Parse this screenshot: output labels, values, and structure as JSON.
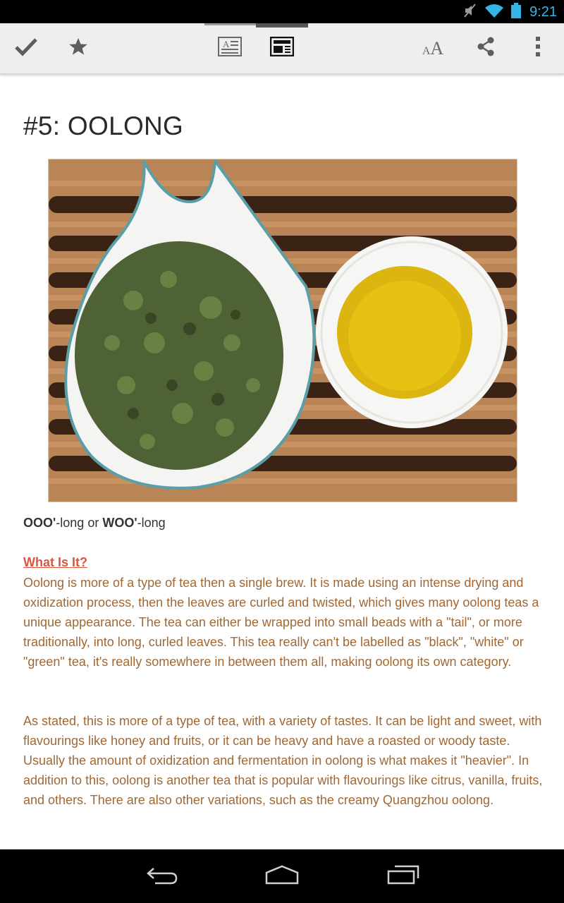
{
  "status_bar": {
    "time": "9:21",
    "icons": [
      "mute-icon",
      "wifi-icon",
      "battery-icon"
    ]
  },
  "action_bar": {
    "buttons": [
      "mark-read-check-icon",
      "star-icon",
      "article-view-icon",
      "web-view-icon",
      "text-size-icon",
      "share-icon",
      "overflow-menu-icon"
    ],
    "text_size_label": "AA"
  },
  "article": {
    "title": "#5: OOLONG",
    "image_alt": "Oolong tea leaves in a white scoop beside a cup of brewed tea on a bamboo tray",
    "pronunciation": {
      "first_bold": "OOO'",
      "first_rest": "-long or ",
      "second_bold": "WOO'",
      "second_rest": "-long"
    },
    "section_heading": "What Is It?",
    "paragraphs": [
      "Oolong is more of a type of tea then a single brew. It is made using an intense drying and oxidization process, then the leaves are curled and twisted, which gives many oolong teas a unique appearance. The tea can either be wrapped into small beads with a \"tail\", or more traditionally, into long, curled leaves. This tea really can't be labelled as \"black\", \"white\" or \"green\" tea, it's really somewhere in between them all, making oolong its own category.",
      "As stated, this is more of a type of tea, with a variety of tastes. It can be light and sweet, with flavourings like honey and fruits, or it can be heavy and have a roasted or woody taste. Usually the amount of oxidization and fermentation in oolong is what makes it \"heavier\". In addition to this, oolong is another tea that is popular with flavourings like citrus, vanilla, fruits, and others. There are also other variations, such as the creamy Quangzhou oolong."
    ]
  },
  "nav_bar": {
    "buttons": [
      "back-icon",
      "home-icon",
      "recent-apps-icon"
    ]
  },
  "colors": {
    "accent_blue": "#33b5e5",
    "heading_red": "#d9573f",
    "body_brown": "#a06836"
  }
}
